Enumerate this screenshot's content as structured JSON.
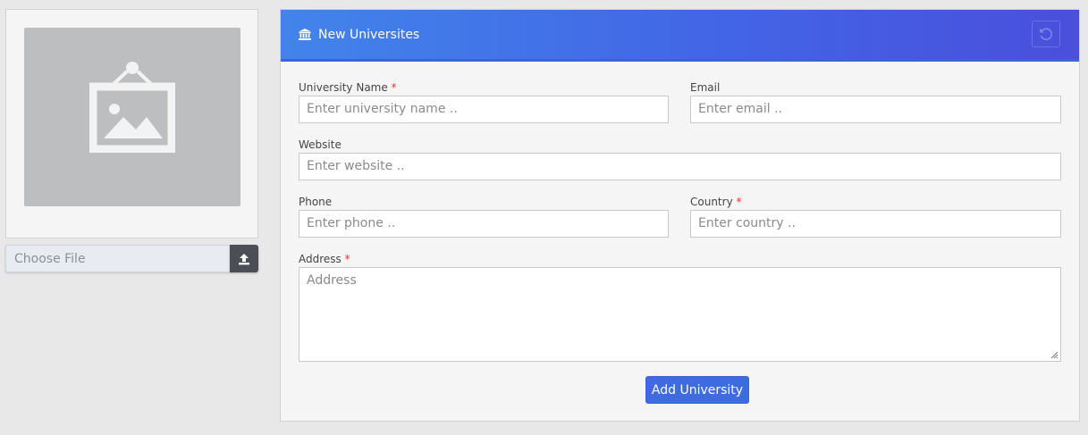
{
  "upload": {
    "file_placeholder": "Choose File",
    "placeholder_icon": "image-placeholder-icon",
    "upload_icon": "upload-icon"
  },
  "panel": {
    "title": "New Universites",
    "title_icon": "university-icon",
    "reset_icon": "undo-icon",
    "header_color": "#4265e6"
  },
  "form": {
    "university_name": {
      "label": "University Name",
      "required": "*",
      "placeholder": "Enter university name .."
    },
    "email": {
      "label": "Email",
      "placeholder": "Enter email .."
    },
    "website": {
      "label": "Website",
      "placeholder": "Enter website .."
    },
    "phone": {
      "label": "Phone",
      "placeholder": "Enter phone .."
    },
    "country": {
      "label": "Country",
      "required": "*",
      "placeholder": "Enter country .."
    },
    "address": {
      "label": "Address",
      "required": "*",
      "placeholder": "Address"
    },
    "submit_label": "Add University"
  }
}
